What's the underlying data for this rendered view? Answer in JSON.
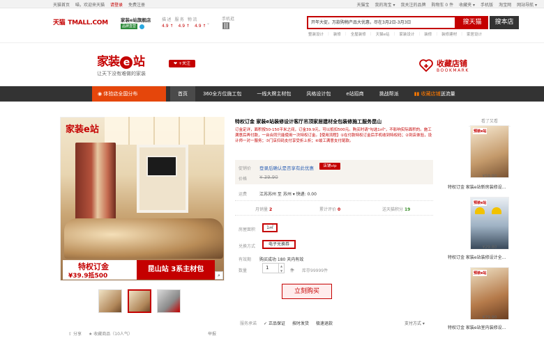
{
  "topbar": {
    "left": [
      "天猫首页",
      "喵，欢迎来天猫",
      "请登录",
      "免费注册"
    ],
    "right": [
      "天猫宝",
      "我的淘宝 ▾",
      "我关注的品牌",
      "购物车 0 件",
      "收藏夹 ▾",
      "手机版",
      "淘宝网",
      "网站导航 ▾"
    ]
  },
  "header": {
    "logo": "天猫",
    "logo_sub": "TMALL.COM",
    "shop_name": "家装e站旗舰店",
    "shop_badge": "品牌直营",
    "service_title": "描述 服务 物流",
    "scores": [
      "4.9 ↑",
      "4.9 ↑",
      "4.9 ↑"
    ],
    "mobile_label": "手机逛",
    "search_placeholder": "开年大促，万款购物产品大优惠，尽在3月2日-3月3日",
    "search_tmall_btn": "搜天猫",
    "search_shop_btn": "搜本店",
    "hotwords": [
      "整装设计",
      "装修",
      "全屋装修",
      "天猫e站",
      "家装设计",
      "装修",
      "装修建材",
      "家居设计"
    ]
  },
  "banner": {
    "logo_a": "家装",
    "logo_e": "e",
    "logo_b": "站",
    "slogan": "让天下没有难做的家装",
    "follow": "❤ +关注",
    "fav_title": "收藏店铺",
    "fav_sub": "BOOKMARK"
  },
  "nav": {
    "location": "体验店全国分布",
    "items": [
      "首页",
      "360全方位施工包",
      "一线大牌主材包",
      "风格设计包",
      "e站招商",
      "挑战帮派"
    ],
    "hot_item_a": "收藏店铺",
    "hot_item_b": "送流量"
  },
  "gallery": {
    "logo": "家装e站",
    "badge_title": "特权订金",
    "badge_price": "¥39.9抵500",
    "badge_right": "昆山站  3系主材包",
    "zoom": "⌕"
  },
  "share": {
    "share": "分享",
    "fav": "收藏商品（10人气）",
    "report": "举报"
  },
  "product": {
    "title": "特权订金 家装e站装修设计客厅吊顶家居建材全包装修施工服务昆山",
    "desc": "订金定详，面积按50-150平米之间，订金39.9元，可以抵扣500元。购买时请\"勾选1㎡\"，不影响实际面积的。施工满意后再付款，一台合同只能使用一次特权订金。【使用流程】①在付款特权订金后手机收到特权码；②到店体验，设计师一对一服务；③门店扫码支付享受折上折；④竣工满意支付尾款。",
    "promo_label": "促销价",
    "promo_value": "登录后确认是否享有此优惠",
    "vip": "店铺vip",
    "price_label": "价格",
    "price_value": "¥ 39.90",
    "ship_label": "运费",
    "ship_value": "江苏苏州  至  苏州 ▾  快递: 0.00",
    "stats": [
      {
        "label": "月销量",
        "value": "2"
      },
      {
        "label": "累计评价",
        "value": "0"
      },
      {
        "label": "送天猫积分",
        "value": "19"
      }
    ],
    "area_label": "房屋面积",
    "area_value": "1㎡",
    "exchange_label": "兑换方式",
    "exchange_value": "电子兑换券",
    "valid_label": "有效期",
    "valid_value": "购买成功 180 天内有效",
    "qty_label": "数量",
    "qty_value": "1",
    "qty_unit": "件",
    "stock": "库存99999件",
    "buy_btn": "立刻购买",
    "commit_label": "服务承诺",
    "commit_items": [
      "✓ 正品保证",
      "按时发货",
      "极速退款"
    ],
    "pay": "支付方式 ▾"
  },
  "side": {
    "title": "看了又看",
    "items": [
      {
        "tag": "预装e站",
        "price": "¥59.90",
        "name": "特权订金 家装e站新房装修设..."
      },
      {
        "tag": "预装e站",
        "price": "¥29.80",
        "name": "特权订金 家装e站装修设计全..."
      },
      {
        "tag": "预装e站",
        "price": "¥79.90",
        "name": "特权订金 家装e站室内装修设..."
      }
    ]
  },
  "colors": {
    "accent": "#c40000",
    "nav_bg": "#333333",
    "nav_loc": "#e5460b"
  }
}
